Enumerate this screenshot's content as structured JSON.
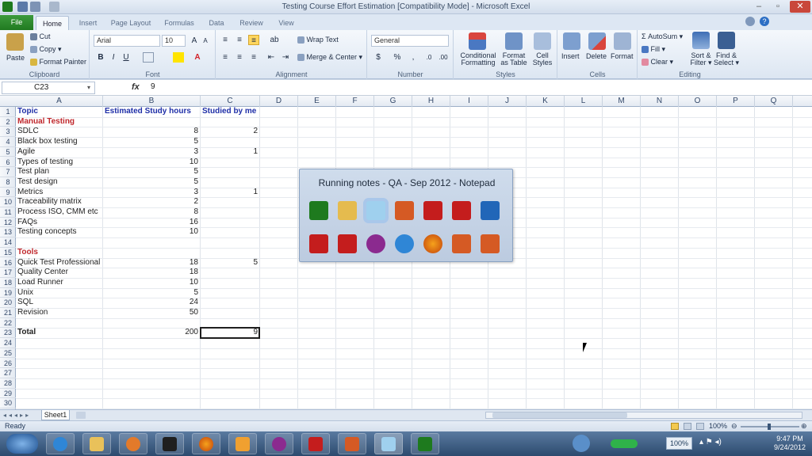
{
  "window": {
    "title": "Testing Course Effort Estimation  [Compatibility Mode]  -  Microsoft Excel"
  },
  "tabs": [
    "File",
    "Home",
    "Insert",
    "Page Layout",
    "Formulas",
    "Data",
    "Review",
    "View"
  ],
  "ribbon": {
    "clipboard": {
      "label": "Clipboard",
      "paste": "Paste",
      "cut": "Cut",
      "copy": "Copy",
      "format_painter": "Format Painter"
    },
    "font": {
      "label": "Font",
      "name": "Arial",
      "size": "10"
    },
    "alignment": {
      "label": "Alignment",
      "wrap": "Wrap Text",
      "merge": "Merge & Center"
    },
    "number": {
      "label": "Number",
      "format": "General"
    },
    "styles": {
      "label": "Styles",
      "conditional": "Conditional",
      "conditional2": "Formatting",
      "format_as": "Format",
      "format_as2": "as Table",
      "cell_styles": "Cell",
      "cell_styles2": "Styles"
    },
    "cells": {
      "label": "Cells",
      "insert": "Insert",
      "delete": "Delete",
      "format": "Format"
    },
    "editing": {
      "label": "Editing",
      "autosum": "AutoSum",
      "fill": "Fill",
      "clear": "Clear",
      "sort": "Sort &",
      "sort2": "Filter",
      "find": "Find &",
      "find2": "Select"
    }
  },
  "formula_bar": {
    "name_box": "C23",
    "fx": "fx",
    "value": "9"
  },
  "columns": [
    "A",
    "B",
    "C",
    "D",
    "E",
    "F",
    "G",
    "H",
    "I",
    "J",
    "K",
    "L",
    "M",
    "N",
    "O",
    "P",
    "Q"
  ],
  "rows": [
    "1",
    "2",
    "3",
    "4",
    "5",
    "6",
    "7",
    "8",
    "9",
    "10",
    "11",
    "12",
    "13",
    "14",
    "15",
    "16",
    "17",
    "18",
    "19",
    "20",
    "21",
    "22",
    "23",
    "24",
    "25",
    "26",
    "27",
    "28",
    "29",
    "30"
  ],
  "table": {
    "headers": [
      "Topic",
      "Estimated Study hours",
      "Studied by me"
    ],
    "section1": "Manual Testing",
    "rows1": [
      [
        "SDLC",
        "8",
        "2"
      ],
      [
        "Black box testing",
        "5",
        ""
      ],
      [
        "Agile",
        "3",
        "1"
      ],
      [
        "Types of testing",
        "10",
        ""
      ],
      [
        "Test plan",
        "5",
        ""
      ],
      [
        "Test design",
        "5",
        ""
      ],
      [
        "Metrics",
        "3",
        "1"
      ],
      [
        "Traceability matrix",
        "2",
        ""
      ],
      [
        "Process ISO, CMM etc",
        "8",
        ""
      ],
      [
        "FAQs",
        "16",
        ""
      ],
      [
        "Testing concepts",
        "10",
        ""
      ]
    ],
    "section2": "Tools",
    "rows2": [
      [
        "Quick Test Professional",
        "18",
        "5"
      ],
      [
        "Quality Center",
        "18",
        ""
      ],
      [
        "Load Runner",
        "10",
        ""
      ],
      [
        "Unix",
        "5",
        ""
      ],
      [
        "SQL",
        "24",
        ""
      ],
      [
        "Revision",
        "50",
        ""
      ]
    ],
    "total": [
      "Total",
      "200",
      "9"
    ]
  },
  "popup": {
    "title": "Running notes - QA - Sep 2012 - Notepad",
    "row1": [
      "excel-icon",
      "folder-icon",
      "notepad-icon",
      "powerpoint-icon",
      "pdf-icon",
      "pdf-icon",
      "monitor-icon"
    ],
    "row2": [
      "pdf-icon",
      "pdf-icon",
      "flower-icon",
      "ie-icon",
      "firefox-icon",
      "powerpoint-icon",
      "powerpoint-icon"
    ]
  },
  "sheet_tab": "Sheet1",
  "status": {
    "text": "Ready",
    "zoom": "100%"
  },
  "tray": {
    "battery": "100%",
    "time": "9:47 PM",
    "date": "9/24/2012"
  }
}
